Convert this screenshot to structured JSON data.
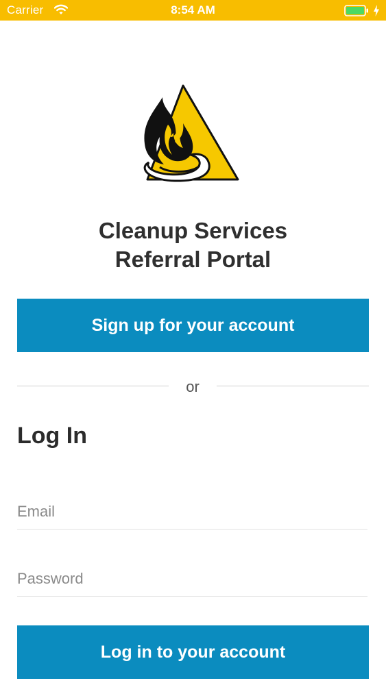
{
  "status_bar": {
    "carrier": "Carrier",
    "time": "8:54 AM",
    "background": "#f8bd00"
  },
  "logo": {
    "icon": "flame-triangle-logo",
    "colors": {
      "triangle": "#f6c800",
      "outline": "#111111"
    }
  },
  "app": {
    "title_line1": "Cleanup Services",
    "title_line2": "Referral Portal"
  },
  "signup": {
    "label": "Sign up for your account"
  },
  "divider": {
    "text": "or"
  },
  "login": {
    "heading": "Log In",
    "email_placeholder": "Email",
    "email_value": "",
    "password_placeholder": "Password",
    "password_value": "",
    "submit_label": "Log in to your account"
  },
  "colors": {
    "primary_button": "#0b8cbf",
    "battery": "#4cd964"
  }
}
